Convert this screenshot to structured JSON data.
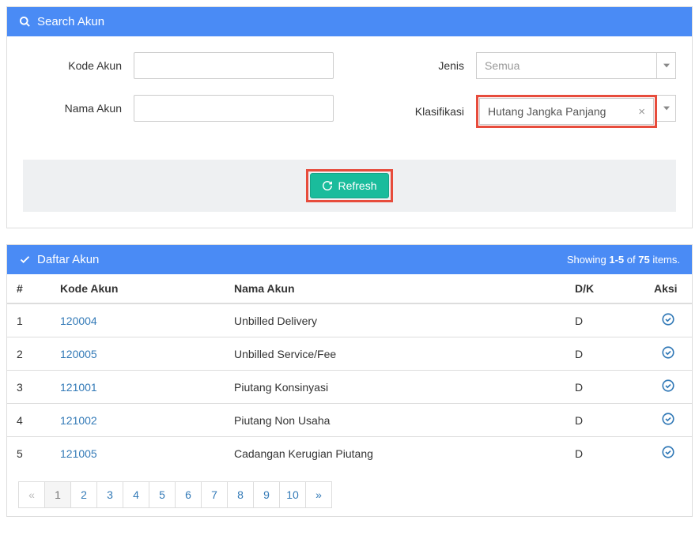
{
  "search": {
    "title": "Search Akun",
    "kode_label": "Kode Akun",
    "kode_value": "",
    "nama_label": "Nama Akun",
    "nama_value": "",
    "jenis_label": "Jenis",
    "jenis_placeholder": "Semua",
    "klas_label": "Klasifikasi",
    "klas_value": "Hutang Jangka Panjang",
    "refresh_label": "Refresh"
  },
  "list": {
    "title": "Daftar Akun",
    "summary_prefix": "Showing ",
    "summary_range": "1-5",
    "summary_mid": " of ",
    "summary_total": "75",
    "summary_suffix": " items.",
    "columns": {
      "num": "#",
      "kode": "Kode Akun",
      "nama": "Nama Akun",
      "dk": "D/K",
      "aksi": "Aksi"
    },
    "rows": [
      {
        "n": "1",
        "kode": "120004",
        "nama": "Unbilled Delivery",
        "dk": "D"
      },
      {
        "n": "2",
        "kode": "120005",
        "nama": "Unbilled Service/Fee",
        "dk": "D"
      },
      {
        "n": "3",
        "kode": "121001",
        "nama": "Piutang Konsinyasi",
        "dk": "D"
      },
      {
        "n": "4",
        "kode": "121002",
        "nama": "Piutang Non Usaha",
        "dk": "D"
      },
      {
        "n": "5",
        "kode": "121005",
        "nama": "Cadangan Kerugian Piutang",
        "dk": "D"
      }
    ],
    "pages": [
      "«",
      "1",
      "2",
      "3",
      "4",
      "5",
      "6",
      "7",
      "8",
      "9",
      "10",
      "»"
    ],
    "active_page": "1"
  }
}
